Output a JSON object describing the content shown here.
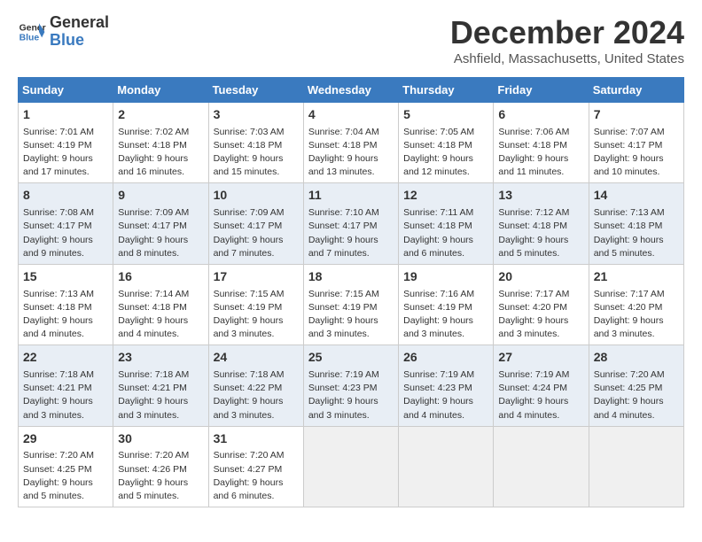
{
  "logo": {
    "line1": "General",
    "line2": "Blue"
  },
  "title": "December 2024",
  "subtitle": "Ashfield, Massachusetts, United States",
  "headers": [
    "Sunday",
    "Monday",
    "Tuesday",
    "Wednesday",
    "Thursday",
    "Friday",
    "Saturday"
  ],
  "weeks": [
    [
      {
        "day": "1",
        "sunrise": "Sunrise: 7:01 AM",
        "sunset": "Sunset: 4:19 PM",
        "daylight": "Daylight: 9 hours and 17 minutes."
      },
      {
        "day": "2",
        "sunrise": "Sunrise: 7:02 AM",
        "sunset": "Sunset: 4:18 PM",
        "daylight": "Daylight: 9 hours and 16 minutes."
      },
      {
        "day": "3",
        "sunrise": "Sunrise: 7:03 AM",
        "sunset": "Sunset: 4:18 PM",
        "daylight": "Daylight: 9 hours and 15 minutes."
      },
      {
        "day": "4",
        "sunrise": "Sunrise: 7:04 AM",
        "sunset": "Sunset: 4:18 PM",
        "daylight": "Daylight: 9 hours and 13 minutes."
      },
      {
        "day": "5",
        "sunrise": "Sunrise: 7:05 AM",
        "sunset": "Sunset: 4:18 PM",
        "daylight": "Daylight: 9 hours and 12 minutes."
      },
      {
        "day": "6",
        "sunrise": "Sunrise: 7:06 AM",
        "sunset": "Sunset: 4:18 PM",
        "daylight": "Daylight: 9 hours and 11 minutes."
      },
      {
        "day": "7",
        "sunrise": "Sunrise: 7:07 AM",
        "sunset": "Sunset: 4:17 PM",
        "daylight": "Daylight: 9 hours and 10 minutes."
      }
    ],
    [
      {
        "day": "8",
        "sunrise": "Sunrise: 7:08 AM",
        "sunset": "Sunset: 4:17 PM",
        "daylight": "Daylight: 9 hours and 9 minutes."
      },
      {
        "day": "9",
        "sunrise": "Sunrise: 7:09 AM",
        "sunset": "Sunset: 4:17 PM",
        "daylight": "Daylight: 9 hours and 8 minutes."
      },
      {
        "day": "10",
        "sunrise": "Sunrise: 7:09 AM",
        "sunset": "Sunset: 4:17 PM",
        "daylight": "Daylight: 9 hours and 7 minutes."
      },
      {
        "day": "11",
        "sunrise": "Sunrise: 7:10 AM",
        "sunset": "Sunset: 4:17 PM",
        "daylight": "Daylight: 9 hours and 7 minutes."
      },
      {
        "day": "12",
        "sunrise": "Sunrise: 7:11 AM",
        "sunset": "Sunset: 4:18 PM",
        "daylight": "Daylight: 9 hours and 6 minutes."
      },
      {
        "day": "13",
        "sunrise": "Sunrise: 7:12 AM",
        "sunset": "Sunset: 4:18 PM",
        "daylight": "Daylight: 9 hours and 5 minutes."
      },
      {
        "day": "14",
        "sunrise": "Sunrise: 7:13 AM",
        "sunset": "Sunset: 4:18 PM",
        "daylight": "Daylight: 9 hours and 5 minutes."
      }
    ],
    [
      {
        "day": "15",
        "sunrise": "Sunrise: 7:13 AM",
        "sunset": "Sunset: 4:18 PM",
        "daylight": "Daylight: 9 hours and 4 minutes."
      },
      {
        "day": "16",
        "sunrise": "Sunrise: 7:14 AM",
        "sunset": "Sunset: 4:18 PM",
        "daylight": "Daylight: 9 hours and 4 minutes."
      },
      {
        "day": "17",
        "sunrise": "Sunrise: 7:15 AM",
        "sunset": "Sunset: 4:19 PM",
        "daylight": "Daylight: 9 hours and 3 minutes."
      },
      {
        "day": "18",
        "sunrise": "Sunrise: 7:15 AM",
        "sunset": "Sunset: 4:19 PM",
        "daylight": "Daylight: 9 hours and 3 minutes."
      },
      {
        "day": "19",
        "sunrise": "Sunrise: 7:16 AM",
        "sunset": "Sunset: 4:19 PM",
        "daylight": "Daylight: 9 hours and 3 minutes."
      },
      {
        "day": "20",
        "sunrise": "Sunrise: 7:17 AM",
        "sunset": "Sunset: 4:20 PM",
        "daylight": "Daylight: 9 hours and 3 minutes."
      },
      {
        "day": "21",
        "sunrise": "Sunrise: 7:17 AM",
        "sunset": "Sunset: 4:20 PM",
        "daylight": "Daylight: 9 hours and 3 minutes."
      }
    ],
    [
      {
        "day": "22",
        "sunrise": "Sunrise: 7:18 AM",
        "sunset": "Sunset: 4:21 PM",
        "daylight": "Daylight: 9 hours and 3 minutes."
      },
      {
        "day": "23",
        "sunrise": "Sunrise: 7:18 AM",
        "sunset": "Sunset: 4:21 PM",
        "daylight": "Daylight: 9 hours and 3 minutes."
      },
      {
        "day": "24",
        "sunrise": "Sunrise: 7:18 AM",
        "sunset": "Sunset: 4:22 PM",
        "daylight": "Daylight: 9 hours and 3 minutes."
      },
      {
        "day": "25",
        "sunrise": "Sunrise: 7:19 AM",
        "sunset": "Sunset: 4:23 PM",
        "daylight": "Daylight: 9 hours and 3 minutes."
      },
      {
        "day": "26",
        "sunrise": "Sunrise: 7:19 AM",
        "sunset": "Sunset: 4:23 PM",
        "daylight": "Daylight: 9 hours and 4 minutes."
      },
      {
        "day": "27",
        "sunrise": "Sunrise: 7:19 AM",
        "sunset": "Sunset: 4:24 PM",
        "daylight": "Daylight: 9 hours and 4 minutes."
      },
      {
        "day": "28",
        "sunrise": "Sunrise: 7:20 AM",
        "sunset": "Sunset: 4:25 PM",
        "daylight": "Daylight: 9 hours and 4 minutes."
      }
    ],
    [
      {
        "day": "29",
        "sunrise": "Sunrise: 7:20 AM",
        "sunset": "Sunset: 4:25 PM",
        "daylight": "Daylight: 9 hours and 5 minutes."
      },
      {
        "day": "30",
        "sunrise": "Sunrise: 7:20 AM",
        "sunset": "Sunset: 4:26 PM",
        "daylight": "Daylight: 9 hours and 5 minutes."
      },
      {
        "day": "31",
        "sunrise": "Sunrise: 7:20 AM",
        "sunset": "Sunset: 4:27 PM",
        "daylight": "Daylight: 9 hours and 6 minutes."
      },
      null,
      null,
      null,
      null
    ]
  ]
}
